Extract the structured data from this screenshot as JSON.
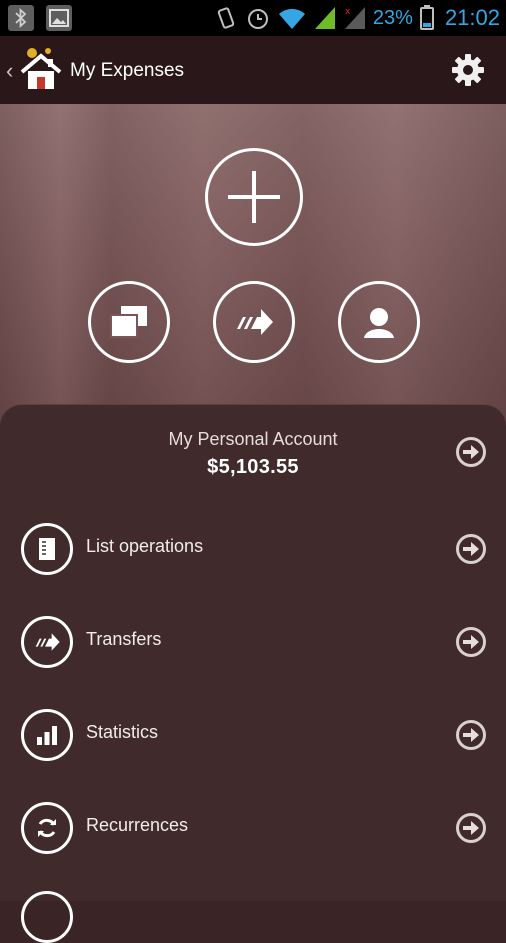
{
  "status_bar": {
    "battery_pct": "23%",
    "time": "21:02",
    "icons": [
      "bluetooth-icon",
      "image-icon",
      "vibrate-icon",
      "alarm-icon",
      "wifi-icon",
      "signal-icon",
      "no-signal-icon",
      "battery-icon"
    ]
  },
  "action_bar": {
    "title": "My Expenses",
    "icons": [
      "back-chevron-icon",
      "app-logo-icon",
      "gear-icon"
    ]
  },
  "hero": {
    "buttons": [
      "add-icon",
      "duplicate-icon",
      "transfer-arrow-icon",
      "person-icon"
    ]
  },
  "account": {
    "name": "My Personal Account",
    "balance": "$5,103.55"
  },
  "menu": {
    "items": [
      {
        "label": "List operations",
        "icon": "list-icon"
      },
      {
        "label": "Transfers",
        "icon": "transfer-arrow-icon"
      },
      {
        "label": "Statistics",
        "icon": "bar-chart-icon"
      },
      {
        "label": "Recurrences",
        "icon": "refresh-icon"
      }
    ]
  },
  "colors": {
    "status_accent": "#33a6e3",
    "action_bar_bg": "#2a1719",
    "panel_bg": "#402a2b"
  }
}
